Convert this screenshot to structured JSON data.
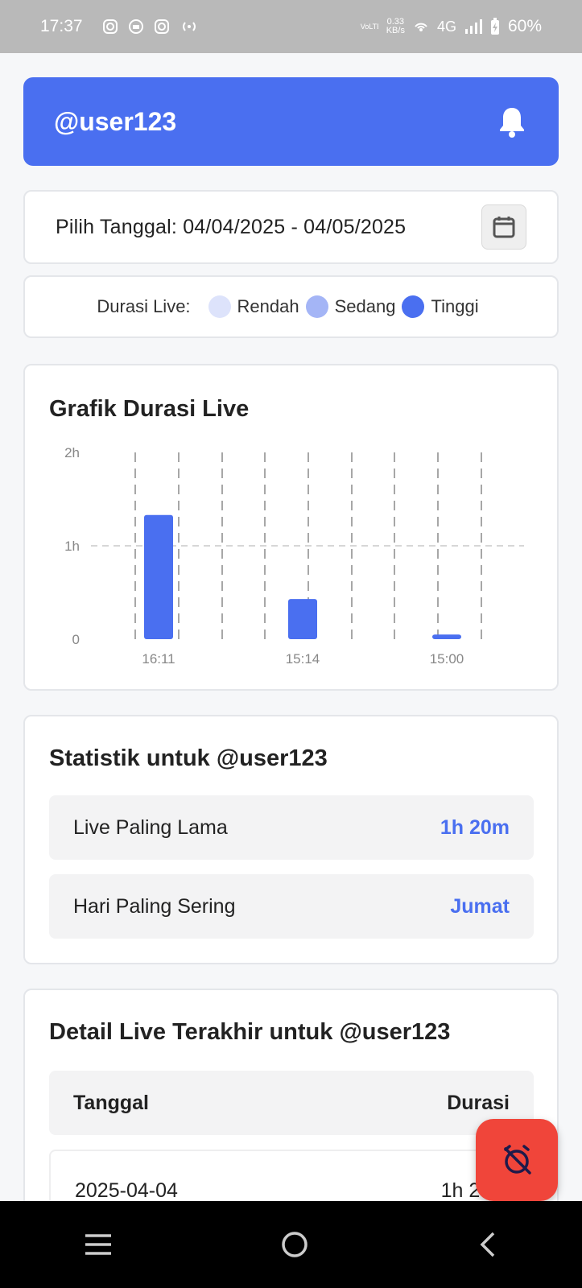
{
  "status_bar": {
    "time": "17:37",
    "net_speed": "0.33",
    "net_unit": "KB/s",
    "network": "4G",
    "lte": "VoLTE",
    "battery": "60%"
  },
  "header": {
    "username": "@user123"
  },
  "date_filter": {
    "label": "Pilih Tanggal: 04/04/2025 - 04/05/2025"
  },
  "legend": {
    "label": "Durasi Live:",
    "items": [
      {
        "label": "Rendah",
        "color": "#dde3fb"
      },
      {
        "label": "Sedang",
        "color": "#a4b5f6"
      },
      {
        "label": "Tinggi",
        "color": "#4a6ff0"
      }
    ]
  },
  "chart": {
    "title": "Grafik Durasi Live"
  },
  "chart_data": {
    "type": "bar",
    "title": "Grafik Durasi Live",
    "categories": [
      "16:11",
      "15:14",
      "15:00"
    ],
    "values": [
      1.33,
      0.43,
      0.05
    ],
    "y_unit": "hours",
    "y_ticks": [
      "0",
      "1h",
      "2h"
    ],
    "ylim": [
      0,
      2
    ],
    "grid": true,
    "bar_color": "#4a6ff0"
  },
  "stats": {
    "title": "Statistik untuk @user123",
    "rows": [
      {
        "label": "Live Paling Lama",
        "value": "1h 20m"
      },
      {
        "label": "Hari Paling Sering",
        "value": "Jumat"
      }
    ]
  },
  "detail": {
    "title": "Detail Live Terakhir untuk @user123",
    "headers": {
      "date": "Tanggal",
      "duration": "Durasi"
    },
    "rows": [
      {
        "date": "2025-04-04",
        "duration": "1h 20m"
      }
    ]
  }
}
